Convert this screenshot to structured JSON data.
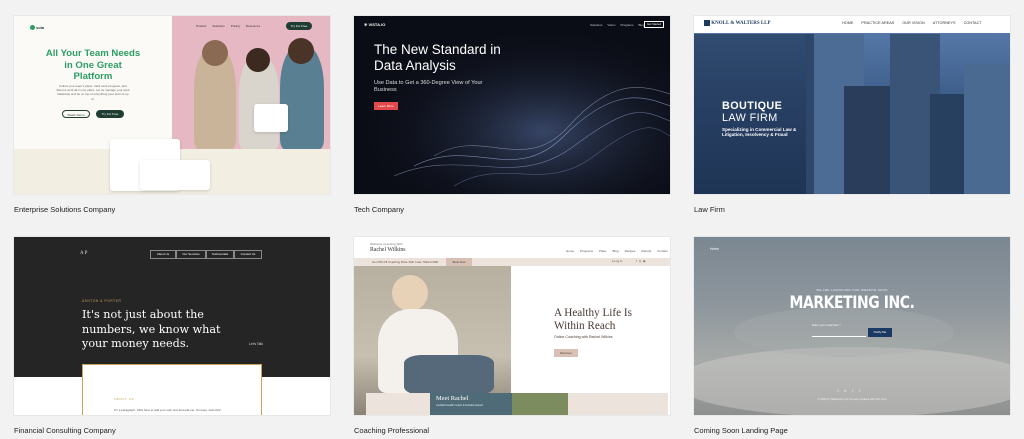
{
  "templates": [
    {
      "caption": "Enterprise Solutions Company",
      "logo": "sola",
      "nav": [
        "Product",
        "Solutions",
        "Pricing",
        "Resources"
      ],
      "nav_cta": "Try For Free",
      "headline": "All Your Team Needs in One Great Platform",
      "body": "Follow your team's plans, track work progress, and discuss work all in one place. Let us manage your work flawlessly and be on top of everything your team is up to.",
      "btn_primary": "Watch Demo",
      "btn_secondary": "Try For Free",
      "colors": {
        "accent": "#2c9e63",
        "pink": "#e6b8c4",
        "dark": "#1f3d33"
      }
    },
    {
      "caption": "Tech Company",
      "logo": "VISTA.IO",
      "nav": [
        "Solutions",
        "Vision",
        "Programs",
        "Blog"
      ],
      "nav_cta": "Get Started",
      "headline": "The New Standard in Data Analysis",
      "subhead": "Use Data to Get a 360-Degree View of Your Business",
      "cta": "Learn More",
      "colors": {
        "accent": "#e2494b"
      }
    },
    {
      "caption": "Law Firm",
      "logo": "KNOLL & WALTERS LLP",
      "nav": [
        "HOME",
        "PRACTICE AREAS",
        "OUR VISION",
        "ATTORNEYS",
        "CONTACT"
      ],
      "headline_line1": "BOUTIQUE",
      "headline_line2": "LAW FIRM",
      "subhead": "Specializing in Commercial Law & Litigation, Insolvency & Fraud",
      "colors": {
        "navy": "#1e3a5f"
      }
    },
    {
      "caption": "Financial Consulting Company",
      "logo": "A P",
      "nav": [
        "About Us",
        "Our Services",
        "Testimonials",
        "Contact Us"
      ],
      "brand": "ASHTON & PORTER",
      "quote": "It's not just about the numbers, we know what your money needs.",
      "cta": "Let's Talk",
      "section_title": "ABOUT US",
      "section_body": "I'm a paragraph. Click here to add your own text and edit me. It's easy. Just click",
      "colors": {
        "gold": "#c7a45a"
      }
    },
    {
      "caption": "Coaching Professional",
      "brand_top": "Wellness Coaching With",
      "brand": "Rachel Wilkins",
      "nav": [
        "Home",
        "Programs",
        "Plans",
        "Blog",
        "Recipes",
        "Refund",
        "Contact"
      ],
      "banner": "Get 20% Off Coaching Plans With Code \"WELCOME\"",
      "banner_cta": "Book Now",
      "login": "Log In",
      "headline": "A Healthy Life Is Within Reach",
      "subhead": "Online Coaching with Rachel Wilkins",
      "cta": "Discover",
      "meet_title": "Meet Rachel",
      "meet_sub": "Certified Health Coach & Nutrition Expert",
      "colors": {
        "accent": "#d8c1b4",
        "teal": "#4f6b78"
      }
    },
    {
      "caption": "Coming Soon Landing Page",
      "logo": "Home",
      "eyebrow": "WE ARE LAUNCHING OUR WEBSITE SOON",
      "headline": "MARKETING INC.",
      "email_label": "Enter your email here *",
      "cta": "Notify Me",
      "footer": "© 2023 by Marketing Inc. Proudly created with Wix.com",
      "colors": {
        "btn": "#1b3a63"
      }
    }
  ]
}
